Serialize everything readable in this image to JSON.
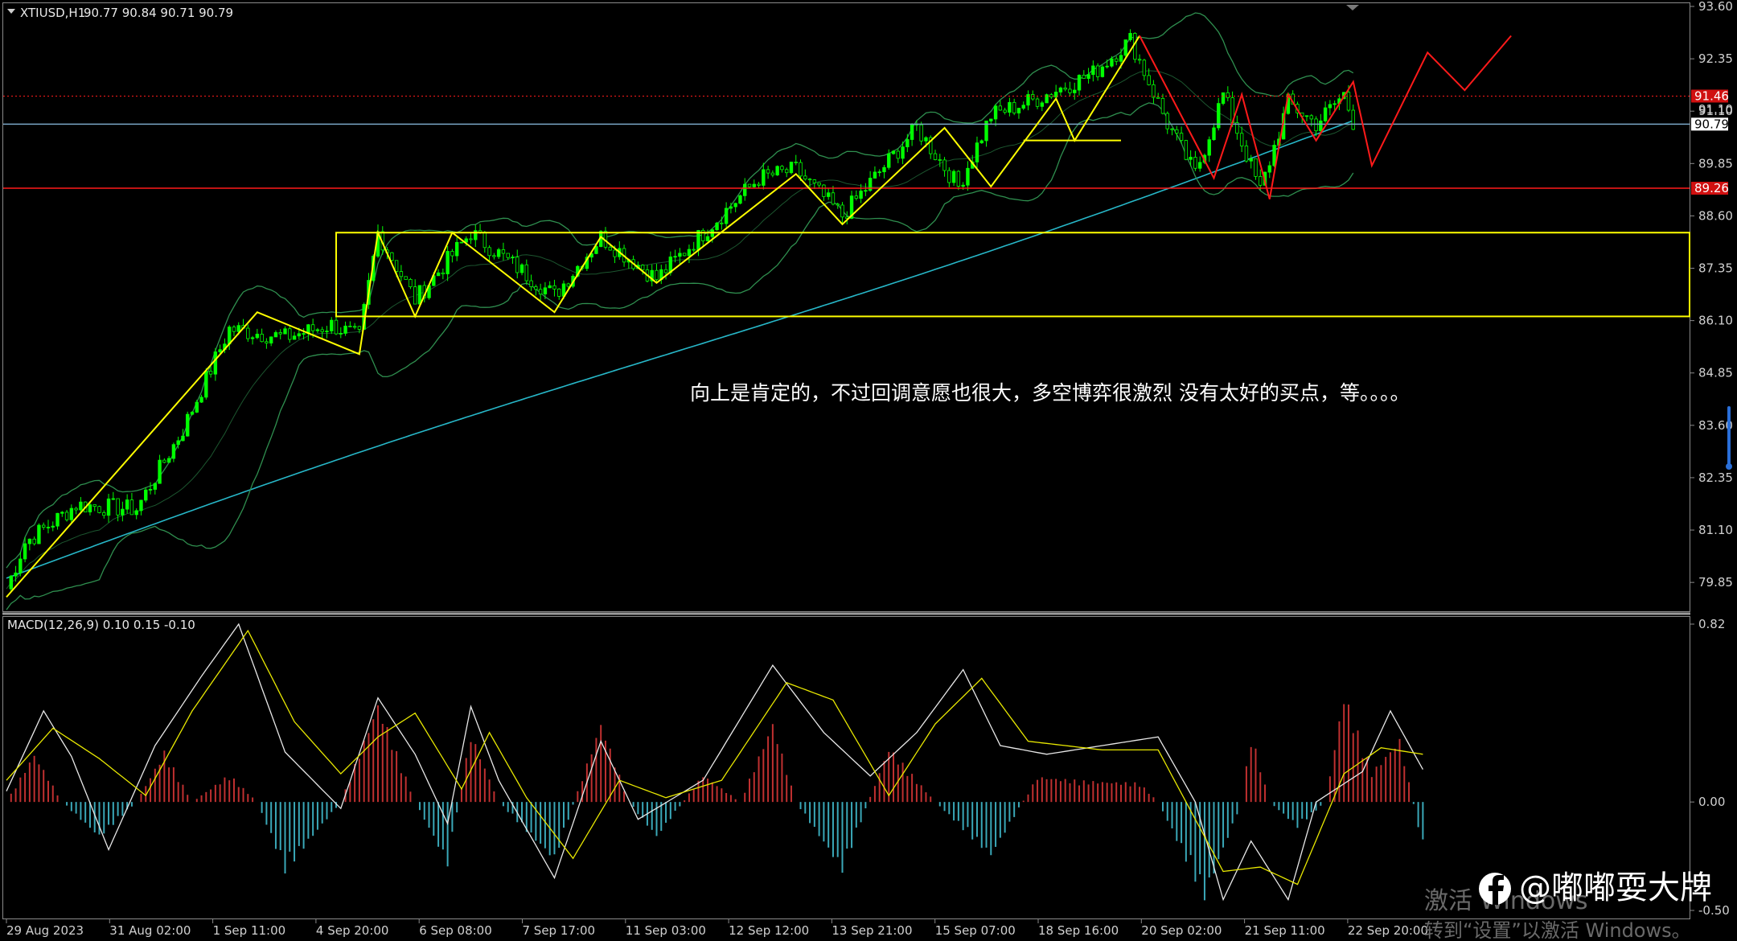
{
  "header": {
    "symbol": "XTIUSD,H1",
    "ohlc": "90.77 90.84 90.71 90.79",
    "macd_label": "MACD(12,26,9) 0.10 0.15 -0.10"
  },
  "annotation": "向上是肯定的，不过回调意愿也很大，多空博弈很激烈 没有太好的买点，等。。。。",
  "watermark": {
    "line1": "激活 Windows",
    "line2": "转到“设置”以激活 Windows。"
  },
  "brand": {
    "text": "@嘟嘟耍大牌",
    "icon": "facebook-icon"
  },
  "colors": {
    "bull": "#00ff00",
    "bear": "#00ff00",
    "bb": "#2f8f4f",
    "ma": "#27b7c8",
    "wave": "#ffff00",
    "forecast": "#ff1a1a",
    "support": "#ff1a1a",
    "macd_pos": "#c03030",
    "macd_neg": "#3aa8b8",
    "macd_line": "#e8e8e8",
    "signal_line": "#e8e800"
  },
  "chart_data": [
    {
      "type": "candlestick",
      "symbol": "XTIUSD",
      "timeframe": "H1",
      "ylim": [
        79.2,
        93.6
      ],
      "y_ticks": [
        93.6,
        92.35,
        91.1,
        89.85,
        88.6,
        87.35,
        86.1,
        84.85,
        83.6,
        82.35,
        81.1,
        79.85
      ],
      "x_ticks": [
        "29 Aug 2023",
        "31 Aug 02:00",
        "1 Sep 11:00",
        "4 Sep 20:00",
        "6 Sep 08:00",
        "7 Sep 17:00",
        "11 Sep 03:00",
        "12 Sep 12:00",
        "13 Sep 21:00",
        "15 Sep 07:00",
        "18 Sep 16:00",
        "20 Sep 02:00",
        "21 Sep 11:00",
        "22 Sep 20:00"
      ],
      "bars": 290,
      "price_path": [
        [
          0,
          79.7
        ],
        [
          4,
          80.8
        ],
        [
          15,
          81.7
        ],
        [
          28,
          81.6
        ],
        [
          38,
          83.5
        ],
        [
          48,
          85.9
        ],
        [
          60,
          85.7
        ],
        [
          70,
          86.0
        ],
        [
          76,
          85.7
        ],
        [
          80,
          88.2
        ],
        [
          88,
          86.6
        ],
        [
          100,
          88.2
        ],
        [
          118,
          86.7
        ],
        [
          128,
          88.1
        ],
        [
          140,
          87.1
        ],
        [
          162,
          89.5
        ],
        [
          170,
          89.7
        ],
        [
          180,
          88.6
        ],
        [
          196,
          90.7
        ],
        [
          205,
          89.3
        ],
        [
          212,
          91.0
        ],
        [
          222,
          91.4
        ],
        [
          234,
          92.0
        ],
        [
          242,
          92.8
        ],
        [
          250,
          90.8
        ],
        [
          256,
          89.6
        ],
        [
          262,
          91.5
        ],
        [
          270,
          89.2
        ],
        [
          276,
          91.3
        ],
        [
          282,
          90.8
        ],
        [
          288,
          91.5
        ],
        [
          292,
          90.2
        ],
        [
          296,
          90.79
        ]
      ],
      "wave_lines": [
        [
          [
            0,
            79.5
          ],
          [
            54,
            86.3
          ],
          [
            76,
            85.3
          ],
          [
            80,
            88.2
          ],
          [
            88,
            86.2
          ],
          [
            96,
            88.2
          ],
          [
            118,
            86.3
          ],
          [
            128,
            88.1
          ],
          [
            140,
            87.0
          ],
          [
            170,
            89.6
          ],
          [
            180,
            88.4
          ],
          [
            202,
            90.7
          ],
          [
            212,
            89.3
          ],
          [
            226,
            91.4
          ],
          [
            230,
            90.4
          ],
          [
            244,
            92.9
          ]
        ]
      ],
      "forecast_line": [
        [
          244,
          92.9
        ],
        [
          252,
          91.2
        ],
        [
          260,
          89.5
        ],
        [
          266,
          91.5
        ],
        [
          272,
          89.0
        ],
        [
          276,
          91.5
        ],
        [
          282,
          90.4
        ],
        [
          290,
          91.8
        ],
        [
          294,
          89.8
        ],
        [
          306,
          92.5
        ],
        [
          314,
          91.6
        ],
        [
          324,
          92.9
        ]
      ],
      "resistance_box": [
        [
          71,
          88.2
        ],
        [
          400,
          86.2
        ]
      ],
      "horizontal_levels": [
        {
          "price": 89.26,
          "label": "89.26",
          "style": "solid",
          "color": "#ff1a1a"
        },
        {
          "price": 91.46,
          "label": "91.46",
          "style": "dotted",
          "color": "#ff1a1a"
        },
        {
          "price": 90.79,
          "label": "90.79",
          "style": "solid",
          "color": "#7aa7c7"
        }
      ],
      "current_price": 90.79,
      "other_price_label": "91.10",
      "mini_support": [
        [
          219,
          90.4
        ],
        [
          240,
          90.4
        ]
      ]
    },
    {
      "type": "macd",
      "params": "12,26,9",
      "values": {
        "main": 0.1,
        "signal": 0.15,
        "hist": -0.1
      },
      "ylim": [
        -0.5,
        0.82
      ],
      "y_ticks": [
        0.82,
        0.0,
        -0.5
      ],
      "hist_path": [
        [
          0,
          0.0
        ],
        [
          6,
          0.23
        ],
        [
          12,
          0.0
        ],
        [
          20,
          -0.17
        ],
        [
          28,
          0.0
        ],
        [
          34,
          0.24
        ],
        [
          40,
          0.0
        ],
        [
          48,
          0.13
        ],
        [
          54,
          0.0
        ],
        [
          60,
          -0.33
        ],
        [
          72,
          0.0
        ],
        [
          80,
          0.47
        ],
        [
          88,
          0.0
        ],
        [
          95,
          -0.3
        ],
        [
          100,
          0.33
        ],
        [
          106,
          0.0
        ],
        [
          118,
          -0.28
        ],
        [
          128,
          0.38
        ],
        [
          134,
          0.0
        ],
        [
          140,
          -0.17
        ],
        [
          150,
          0.13
        ],
        [
          158,
          0.0
        ],
        [
          165,
          0.38
        ],
        [
          170,
          0.0
        ],
        [
          180,
          -0.33
        ],
        [
          190,
          0.26
        ],
        [
          200,
          0.0
        ],
        [
          212,
          -0.26
        ],
        [
          222,
          0.12
        ],
        [
          232,
          0.1
        ],
        [
          244,
          0.09
        ],
        [
          248,
          0.0
        ],
        [
          258,
          -0.46
        ],
        [
          266,
          0.0
        ],
        [
          268,
          0.33
        ],
        [
          272,
          0.0
        ],
        [
          278,
          -0.12
        ],
        [
          284,
          0.0
        ],
        [
          288,
          0.52
        ],
        [
          294,
          0.14
        ],
        [
          300,
          0.3
        ],
        [
          305,
          -0.22
        ]
      ],
      "main_path": [
        [
          0,
          0.05
        ],
        [
          8,
          0.42
        ],
        [
          14,
          0.21
        ],
        [
          22,
          -0.22
        ],
        [
          32,
          0.26
        ],
        [
          42,
          0.58
        ],
        [
          50,
          0.82
        ],
        [
          60,
          0.23
        ],
        [
          72,
          -0.03
        ],
        [
          80,
          0.48
        ],
        [
          88,
          0.22
        ],
        [
          95,
          -0.1
        ],
        [
          100,
          0.44
        ],
        [
          106,
          0.1
        ],
        [
          118,
          -0.35
        ],
        [
          128,
          0.28
        ],
        [
          136,
          -0.08
        ],
        [
          150,
          0.1
        ],
        [
          165,
          0.63
        ],
        [
          176,
          0.32
        ],
        [
          186,
          0.12
        ],
        [
          196,
          0.32
        ],
        [
          206,
          0.61
        ],
        [
          214,
          0.26
        ],
        [
          224,
          0.22
        ],
        [
          248,
          0.3
        ],
        [
          256,
          0.0
        ],
        [
          262,
          -0.45
        ],
        [
          268,
          -0.18
        ],
        [
          276,
          -0.45
        ],
        [
          282,
          0.0
        ],
        [
          292,
          0.14
        ],
        [
          298,
          0.42
        ],
        [
          305,
          0.15
        ]
      ],
      "signal_path": [
        [
          0,
          0.1
        ],
        [
          10,
          0.34
        ],
        [
          20,
          0.2
        ],
        [
          30,
          0.03
        ],
        [
          40,
          0.42
        ],
        [
          52,
          0.79
        ],
        [
          62,
          0.37
        ],
        [
          72,
          0.13
        ],
        [
          80,
          0.3
        ],
        [
          88,
          0.41
        ],
        [
          98,
          0.06
        ],
        [
          104,
          0.32
        ],
        [
          112,
          0.02
        ],
        [
          122,
          -0.26
        ],
        [
          132,
          0.1
        ],
        [
          142,
          0.02
        ],
        [
          154,
          0.1
        ],
        [
          168,
          0.55
        ],
        [
          178,
          0.47
        ],
        [
          190,
          0.03
        ],
        [
          200,
          0.36
        ],
        [
          210,
          0.57
        ],
        [
          220,
          0.28
        ],
        [
          236,
          0.24
        ],
        [
          248,
          0.24
        ],
        [
          262,
          -0.32
        ],
        [
          270,
          -0.3
        ],
        [
          278,
          -0.38
        ],
        [
          288,
          0.13
        ],
        [
          296,
          0.25
        ],
        [
          305,
          0.22
        ]
      ]
    }
  ]
}
